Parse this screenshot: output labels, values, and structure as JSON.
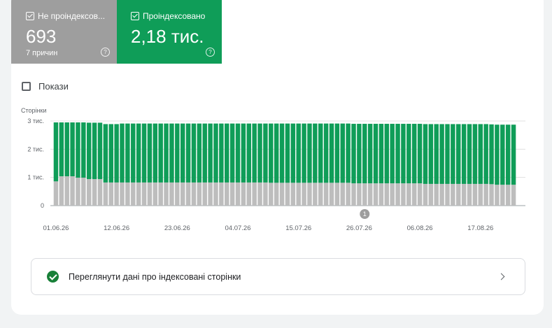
{
  "tiles": {
    "not_indexed": {
      "label": "Не проіндексов...",
      "value": "693",
      "sub": "7 причин",
      "color": "#9e9e9e"
    },
    "indexed": {
      "label": "Проіндексовано",
      "value": "2,18 тис.",
      "color": "#0f9d58"
    },
    "help_icon": "?"
  },
  "show_toggle": {
    "label": "Покази",
    "checked": false
  },
  "chart_data": {
    "type": "bar",
    "stacked": true,
    "ylabel": "Сторінки",
    "ylim": [
      0,
      3000
    ],
    "yticks": [
      "0",
      "1 тис.",
      "2 тис.",
      "3 тис."
    ],
    "xticks": [
      "01.06.26",
      "12.06.26",
      "23.06.26",
      "04.07.26",
      "15.07.26",
      "26.07.26",
      "06.08.26",
      "17.08.26"
    ],
    "annotation": {
      "label": "1",
      "at_bar": 56
    },
    "colors": {
      "indexed": "#0f9d58",
      "not_indexed": "#bdbdbd"
    },
    "series": [
      {
        "name": "Не проіндексов...",
        "values": [
          860,
          1040,
          1040,
          1040,
          990,
          990,
          940,
          940,
          940,
          820,
          820,
          820,
          820,
          820,
          820,
          820,
          820,
          820,
          820,
          820,
          820,
          820,
          820,
          820,
          820,
          820,
          820,
          820,
          820,
          820,
          820,
          820,
          820,
          820,
          820,
          820,
          820,
          820,
          820,
          810,
          810,
          810,
          810,
          810,
          810,
          810,
          810,
          810,
          810,
          810,
          810,
          810,
          810,
          810,
          790,
          790,
          790,
          790,
          790,
          790,
          790,
          790,
          790,
          790,
          790,
          790,
          790,
          770,
          770,
          770,
          770,
          770,
          770,
          770,
          770,
          770,
          770,
          770,
          770,
          760,
          740,
          740,
          740,
          740
        ]
      },
      {
        "name": "Проіндексовано",
        "values": [
          2090,
          1910,
          1910,
          1910,
          1960,
          1960,
          2000,
          2000,
          2000,
          2070,
          2070,
          2070,
          2090,
          2090,
          2090,
          2090,
          2090,
          2090,
          2090,
          2090,
          2090,
          2090,
          2090,
          2090,
          2090,
          2090,
          2090,
          2090,
          2090,
          2090,
          2090,
          2090,
          2090,
          2090,
          2090,
          2090,
          2090,
          2090,
          2090,
          2100,
          2100,
          2100,
          2100,
          2100,
          2100,
          2100,
          2100,
          2100,
          2100,
          2100,
          2100,
          2100,
          2100,
          2100,
          2110,
          2110,
          2110,
          2110,
          2110,
          2110,
          2110,
          2110,
          2110,
          2110,
          2110,
          2110,
          2110,
          2120,
          2120,
          2120,
          2120,
          2120,
          2120,
          2120,
          2120,
          2120,
          2120,
          2120,
          2120,
          2120,
          2130,
          2130,
          2130,
          2130
        ]
      }
    ]
  },
  "review_link": {
    "label": "Переглянути дані про індексовані сторінки"
  }
}
